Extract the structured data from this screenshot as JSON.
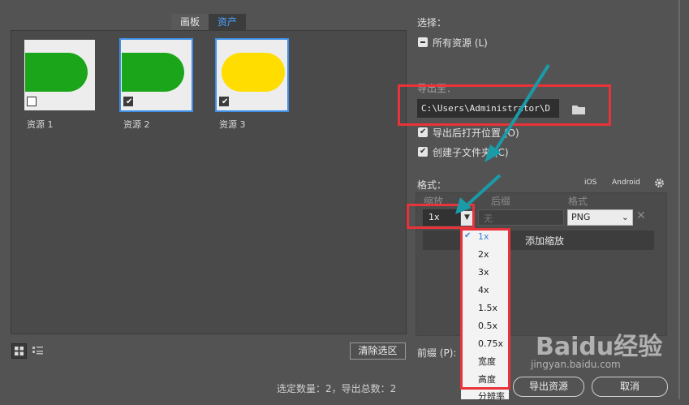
{
  "tabs": [
    {
      "label": "画板"
    },
    {
      "label": "资产"
    }
  ],
  "assets": [
    {
      "name": "资源 1",
      "color": "#1aa51a",
      "checked": false
    },
    {
      "name": "资源 2",
      "color": "#1aa51a",
      "checked": true
    },
    {
      "name": "资源 3",
      "color": "#ffdd00",
      "checked": true
    }
  ],
  "select": {
    "heading": "选择：",
    "all_assets": "所有资源 (L)"
  },
  "export_to": {
    "heading": "导出至：",
    "path": "C:\\Users\\Administrator\\D",
    "open_after": "导出后打开位置 (O)",
    "create_subfolders": "创建子文件夹 (C)"
  },
  "format": {
    "heading": "格式：",
    "ios": "iOS",
    "android": "Android",
    "col_scale": "缩放",
    "col_suffix": "后缀",
    "col_format": "格式",
    "scale_value": "1x",
    "suffix_placeholder": "无",
    "format_value": "PNG",
    "add_scale": "添加缩放"
  },
  "scale_menu": [
    "1x",
    "2x",
    "3x",
    "4x",
    "1.5x",
    "0.5x",
    "0.75x",
    "宽度",
    "高度",
    "分辨率"
  ],
  "prefix_label": "前缀 (P):",
  "clear_selection": "清除选区",
  "status": "选定数量：2，导出总数：2",
  "export_button": "导出资源",
  "cancel_button": "取消",
  "watermark": {
    "brand": "Baidu经验",
    "url": "jingyan.baidu.com"
  }
}
